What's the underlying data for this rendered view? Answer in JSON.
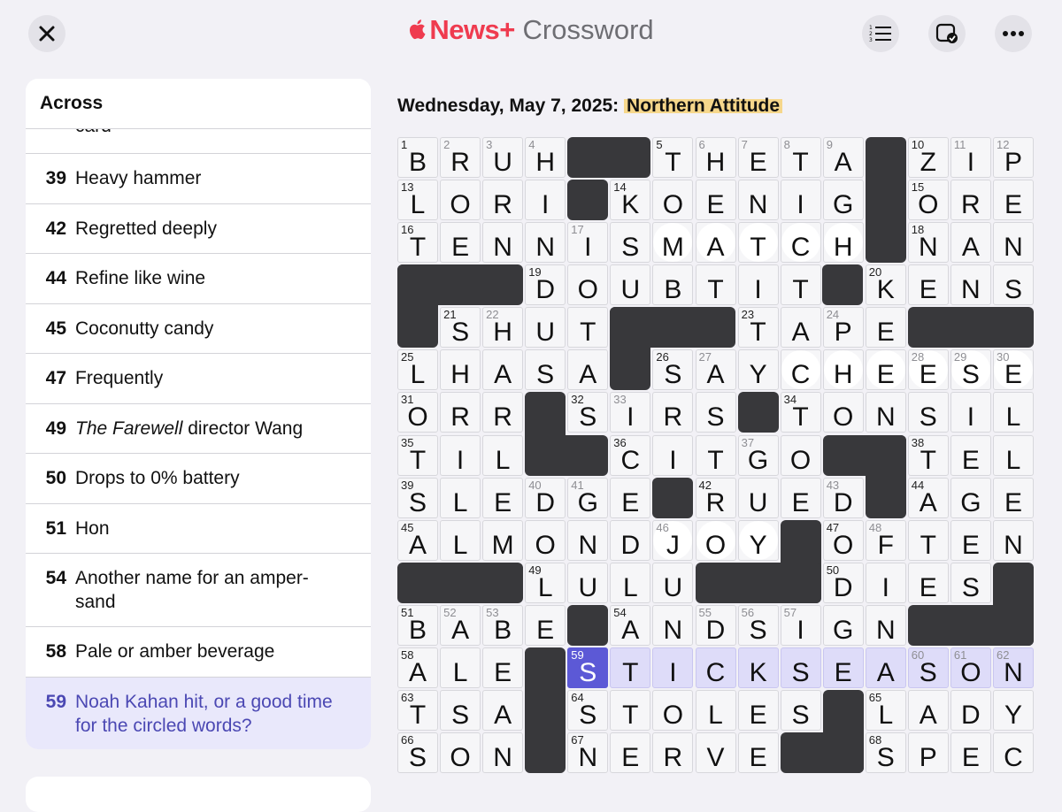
{
  "header": {
    "brand_apple": "",
    "brand_news": "News+",
    "brand_product": " Crossword",
    "close_icon": "close-icon",
    "list_icon": "clue-list-icon",
    "check_icon": "check-puzzle-icon",
    "more_icon": "more-icon"
  },
  "clues": {
    "heading": "Across",
    "partial_text": "card",
    "items": [
      {
        "num": "39",
        "text": "Heavy hammer"
      },
      {
        "num": "42",
        "text": "Regretted deeply"
      },
      {
        "num": "44",
        "text": "Refine like wine"
      },
      {
        "num": "45",
        "text": "Coconutty candy"
      },
      {
        "num": "47",
        "text": "Frequently"
      },
      {
        "num": "49",
        "text_italic": "The Farewell",
        "text_rest": " director Wang"
      },
      {
        "num": "50",
        "text": "Drops to 0% battery"
      },
      {
        "num": "51",
        "text": "Hon"
      },
      {
        "num": "54",
        "text": "Another name for an amper-sand"
      },
      {
        "num": "58",
        "text": "Pale or amber beverage"
      },
      {
        "num": "59",
        "text": "Noah Kahan hit, or a good time for the circled words?",
        "active": true
      }
    ]
  },
  "puzzle": {
    "date": "Wednesday, May 7, 2025:",
    "title": "Northern Attitude"
  },
  "grid": {
    "rows": [
      "BRUH#THETA#ZIP",
      "LORI#KOENIG#ORE",
      "TENNISMATCH#NAN",
      "##DOUBTIT#KENS",
      "#SHUT###TAPE###",
      "LHASA#SAYCHEESE",
      "ORR##SIRS#TONSIL",
      "TIL##CITGO##TEL",
      "SLEDGE#RUED#AGE",
      "ALMONDJOY#OFTEN",
      "##LULU###DIES#",
      "BABE#ANDSIGN###",
      "ALE#STICKSEASON",
      "TSA#STOLES#LADY",
      "SON#NERVE##SPEC"
    ],
    "cells": [
      [
        "B",
        "R",
        "U",
        "H",
        "#",
        "#",
        "T",
        "H",
        "E",
        "T",
        "A",
        "#",
        "Z",
        "I",
        "P"
      ],
      [
        "L",
        "O",
        "R",
        "I",
        "#",
        "K",
        "O",
        "E",
        "N",
        "I",
        "G",
        "#",
        "O",
        "R",
        "E"
      ],
      [
        "T",
        "E",
        "N",
        "N",
        "I",
        "S",
        "M",
        "A",
        "T",
        "C",
        "H",
        "#",
        "N",
        "A",
        "N"
      ],
      [
        "#",
        "#",
        "#",
        "D",
        "O",
        "U",
        "B",
        "T",
        "I",
        "T",
        "#",
        "K",
        "E",
        "N",
        "S"
      ],
      [
        "#",
        "S",
        "H",
        "U",
        "T",
        "#",
        "#",
        "#",
        "T",
        "A",
        "P",
        "E",
        "#",
        "#",
        "#"
      ],
      [
        "L",
        "H",
        "A",
        "S",
        "A",
        "#",
        "S",
        "A",
        "Y",
        "C",
        "H",
        "E",
        "E",
        "S",
        "E"
      ],
      [
        "O",
        "R",
        "R",
        "#",
        "S",
        "I",
        "R",
        "S",
        "#",
        "T",
        "O",
        "N",
        "S",
        "I",
        "L"
      ],
      [
        "T",
        "I",
        "L",
        "#",
        "#",
        "C",
        "I",
        "T",
        "G",
        "O",
        "#",
        "#",
        "T",
        "E",
        "L"
      ],
      [
        "S",
        "L",
        "E",
        "D",
        "G",
        "E",
        "#",
        "R",
        "U",
        "E",
        "D",
        "#",
        "A",
        "G",
        "E"
      ],
      [
        "A",
        "L",
        "M",
        "O",
        "N",
        "D",
        "J",
        "O",
        "Y",
        "#",
        "O",
        "F",
        "T",
        "E",
        "N"
      ],
      [
        "#",
        "#",
        "#",
        "L",
        "U",
        "L",
        "U",
        "#",
        "#",
        "#",
        "D",
        "I",
        "E",
        "S",
        "#"
      ],
      [
        "B",
        "A",
        "B",
        "E",
        "#",
        "A",
        "N",
        "D",
        "S",
        "I",
        "G",
        "N",
        "#",
        "#",
        "#"
      ],
      [
        "A",
        "L",
        "E",
        "#",
        "S",
        "T",
        "I",
        "C",
        "K",
        "S",
        "E",
        "A",
        "S",
        "O",
        "N"
      ],
      [
        "T",
        "S",
        "A",
        "#",
        "S",
        "T",
        "O",
        "L",
        "E",
        "S",
        "#",
        "L",
        "A",
        "D",
        "Y"
      ],
      [
        "S",
        "O",
        "N",
        "#",
        "N",
        "E",
        "R",
        "V",
        "E",
        "#",
        "#",
        "S",
        "P",
        "E",
        "C"
      ]
    ],
    "numbers": [
      [
        1,
        0,
        "1"
      ],
      [
        1,
        1,
        "2"
      ],
      [
        1,
        2,
        "3"
      ],
      [
        1,
        3,
        "4"
      ],
      [
        1,
        6,
        "5"
      ],
      [
        1,
        7,
        "6"
      ],
      [
        1,
        8,
        "7"
      ],
      [
        1,
        9,
        "8"
      ],
      [
        1,
        10,
        "9"
      ],
      [
        1,
        12,
        "10"
      ],
      [
        1,
        13,
        "11"
      ],
      [
        1,
        14,
        "12"
      ]
    ],
    "current_cell": "59",
    "colors": {
      "block": "#38383b",
      "cell": "#f6f6f8",
      "highlight": "#dedcf9",
      "current": "#5c59d6",
      "title_highlight": "#f6d78b"
    }
  }
}
